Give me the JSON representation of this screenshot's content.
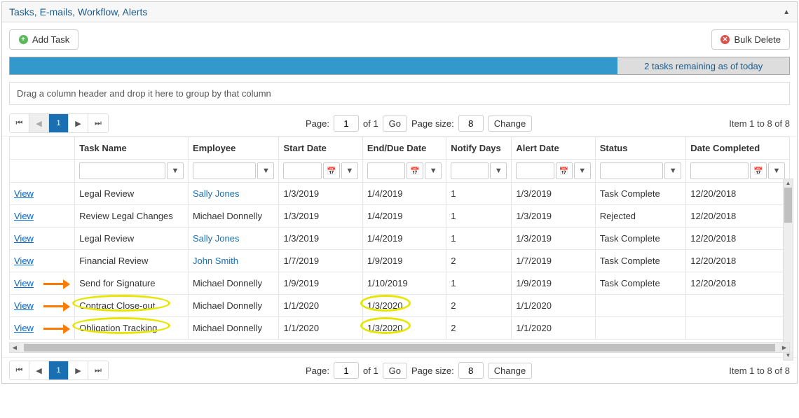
{
  "header": {
    "title": "Tasks, E-mails, Workflow, Alerts"
  },
  "toolbar": {
    "add_label": "Add Task",
    "bulk_delete_label": "Bulk Delete"
  },
  "status": {
    "text": "2 tasks remaining as of today"
  },
  "group_drop": {
    "text": "Drag a column header and drop it here to group by that column"
  },
  "pager": {
    "page_label": "Page:",
    "page_value": "1",
    "of_label": "of 1",
    "go_label": "Go",
    "size_label": "Page size:",
    "size_value": "8",
    "change_label": "Change",
    "range_text": "Item 1 to 8 of 8",
    "current_page": "1"
  },
  "columns": {
    "view": "",
    "task_name": "Task Name",
    "employee": "Employee",
    "start_date": "Start Date",
    "end_date": "End/Due Date",
    "notify_days": "Notify Days",
    "alert_date": "Alert Date",
    "status": "Status",
    "date_completed": "Date Completed"
  },
  "view_label": "View",
  "rows": [
    {
      "task": "Legal Review",
      "employee": "Sally Jones",
      "emp_link": true,
      "start": "1/3/2019",
      "end": "1/4/2019",
      "notify": "1",
      "alert": "1/3/2019",
      "status": "Task Complete",
      "completed": "12/20/2018"
    },
    {
      "task": "Review Legal Changes",
      "employee": "Michael Donnelly",
      "emp_link": false,
      "start": "1/3/2019",
      "end": "1/4/2019",
      "notify": "1",
      "alert": "1/3/2019",
      "status": "Rejected",
      "completed": "12/20/2018"
    },
    {
      "task": "Legal Review",
      "employee": "Sally Jones",
      "emp_link": true,
      "start": "1/3/2019",
      "end": "1/4/2019",
      "notify": "1",
      "alert": "1/3/2019",
      "status": "Task Complete",
      "completed": "12/20/2018"
    },
    {
      "task": "Financial Review",
      "employee": "John Smith",
      "emp_link": true,
      "start": "1/7/2019",
      "end": "1/9/2019",
      "notify": "2",
      "alert": "1/7/2019",
      "status": "Task Complete",
      "completed": "12/20/2018"
    },
    {
      "task": "Send for Signature",
      "employee": "Michael Donnelly",
      "emp_link": false,
      "start": "1/9/2019",
      "end": "1/10/2019",
      "notify": "1",
      "alert": "1/9/2019",
      "status": "Task Complete",
      "completed": "12/20/2018"
    },
    {
      "task": "Contract Close-out",
      "employee": "Michael Donnelly",
      "emp_link": false,
      "start": "1/1/2020",
      "end": "1/3/2020",
      "notify": "2",
      "alert": "1/1/2020",
      "status": "",
      "completed": ""
    },
    {
      "task": "Obligation Tracking",
      "employee": "Michael Donnelly",
      "emp_link": false,
      "start": "1/1/2020",
      "end": "1/3/2020",
      "notify": "2",
      "alert": "1/1/2020",
      "status": "",
      "completed": ""
    }
  ]
}
